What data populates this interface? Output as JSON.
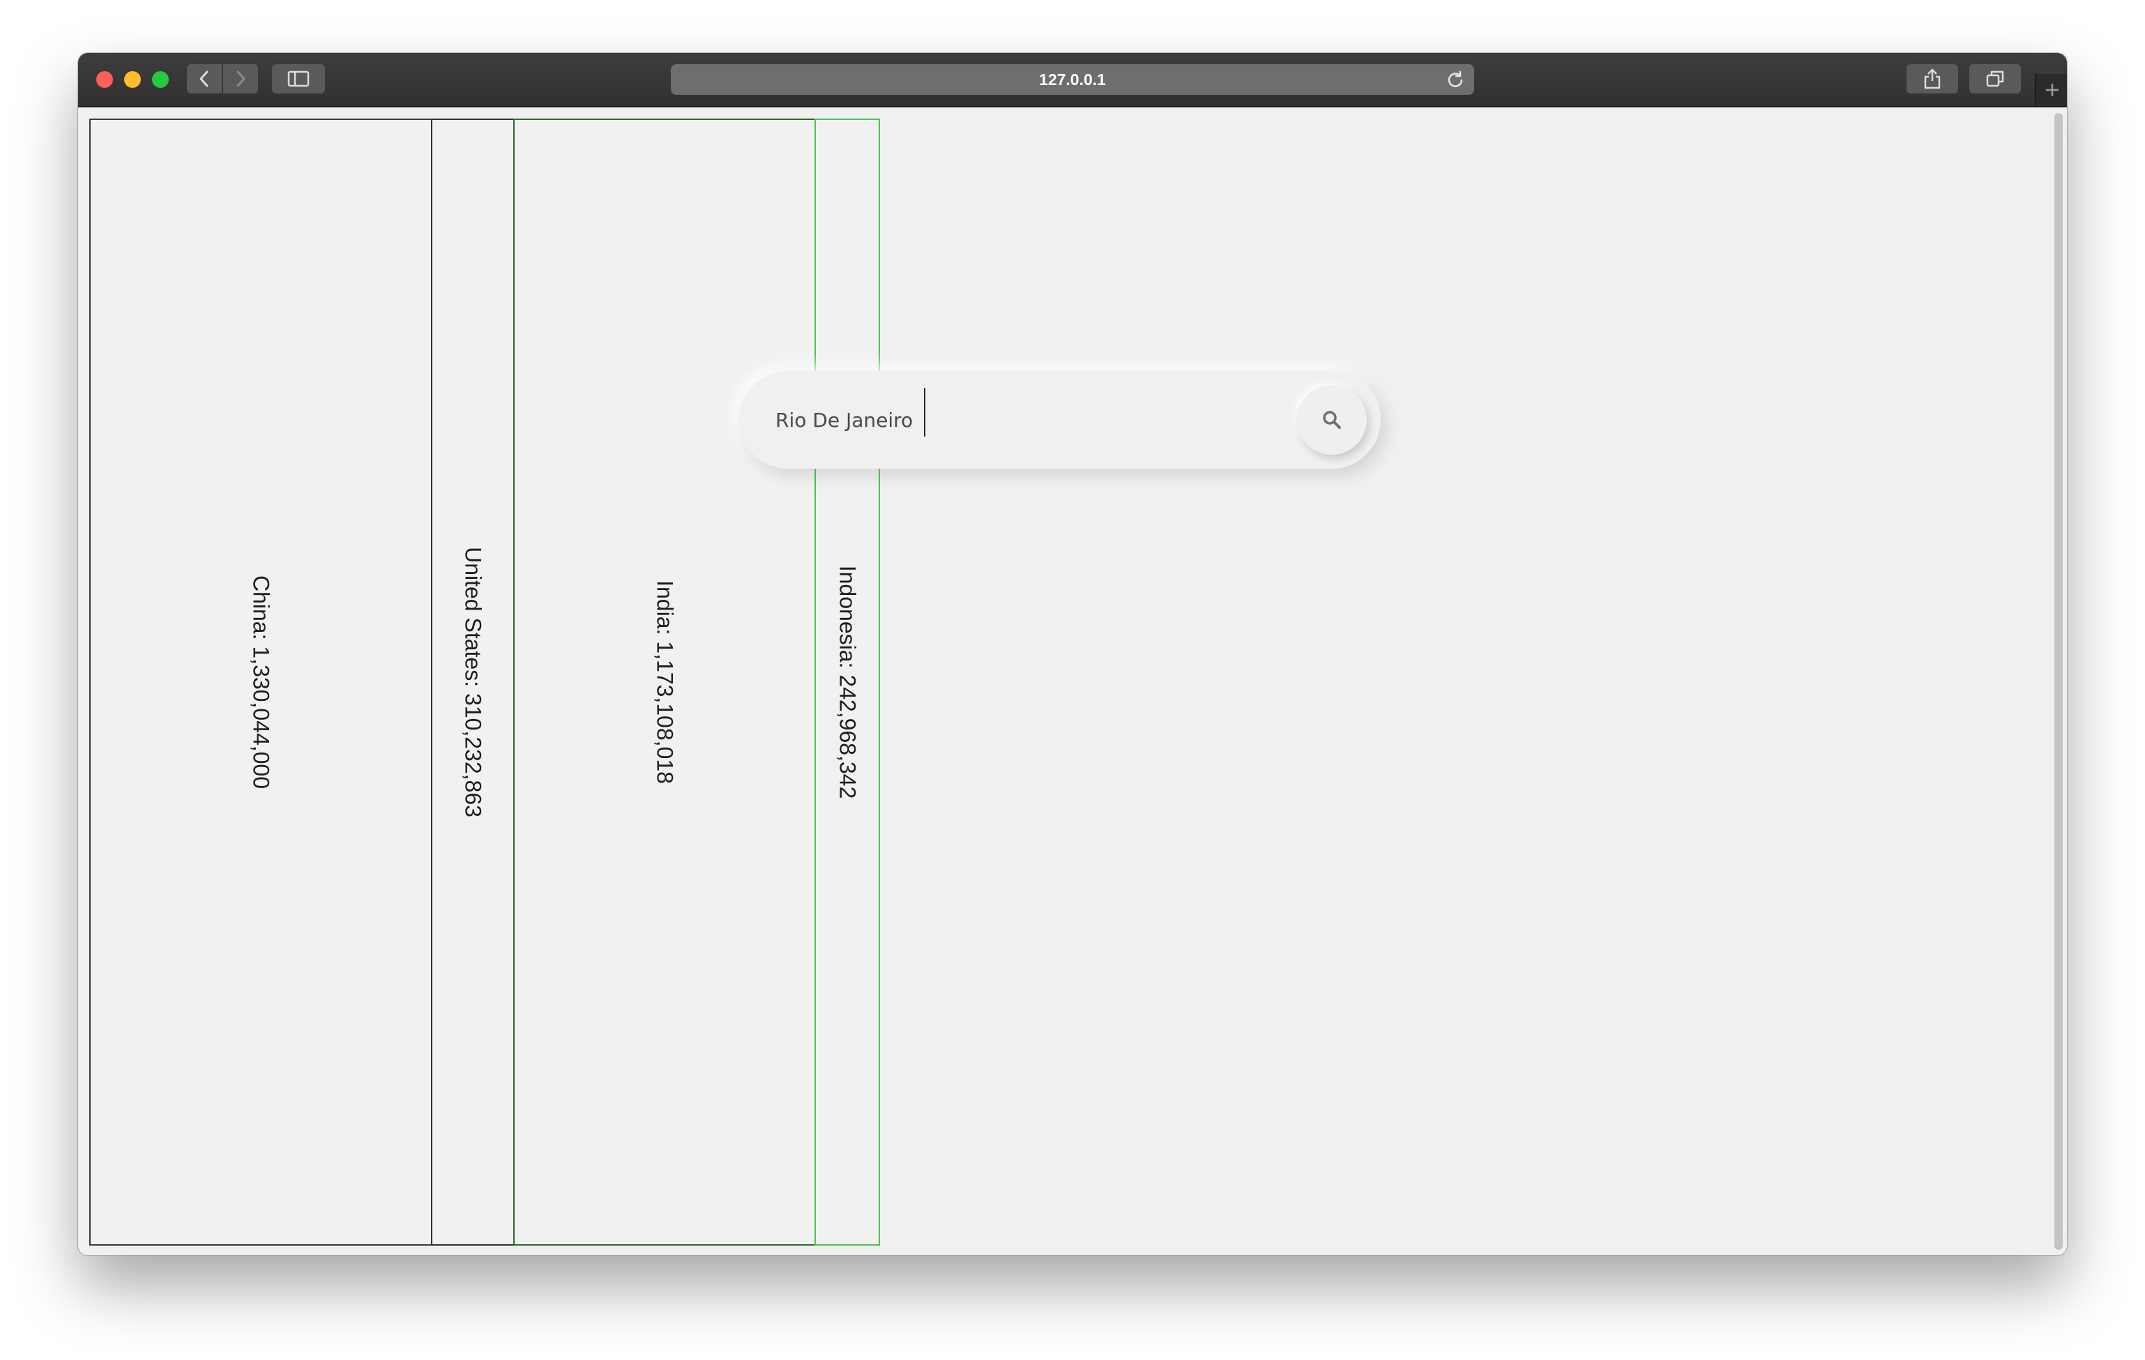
{
  "browser": {
    "url": "127.0.0.1"
  },
  "search": {
    "value": "Rio De Janeiro"
  },
  "bars": [
    {
      "label": "China: 1,330,044,000",
      "border_color": "#3a3a3a"
    },
    {
      "label": "United States: 310,232,863",
      "border_color": "#3a2a3a"
    },
    {
      "label": "India: 1,173,108,018",
      "border_color": "#2f6a2f"
    },
    {
      "label": "Indonesia: 242,968,342",
      "border_color": "#4ec24e"
    }
  ],
  "icons": {
    "back": "chevron-left-icon",
    "forward": "chevron-right-icon",
    "sidebar": "sidebar-icon",
    "reload": "reload-icon",
    "share": "share-icon",
    "tabs": "tabs-icon",
    "new_tab": "plus-icon",
    "search": "search-icon"
  }
}
